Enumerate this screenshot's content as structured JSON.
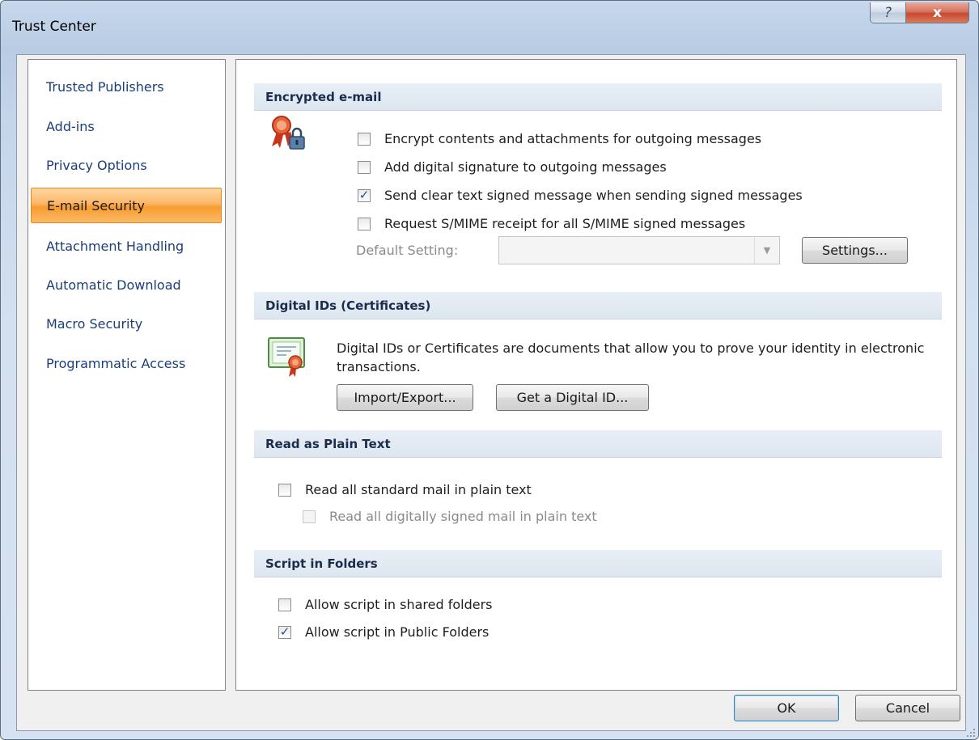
{
  "window": {
    "title": "Trust Center",
    "help_glyph": "?",
    "close_glyph": "x"
  },
  "sidebar": {
    "items": [
      {
        "label": "Trusted Publishers",
        "active": false
      },
      {
        "label": "Add-ins",
        "active": false
      },
      {
        "label": "Privacy Options",
        "active": false
      },
      {
        "label": "E-mail Security",
        "active": true
      },
      {
        "label": "Attachment Handling",
        "active": false
      },
      {
        "label": "Automatic Download",
        "active": false
      },
      {
        "label": "Macro Security",
        "active": false
      },
      {
        "label": "Programmatic Access",
        "active": false
      }
    ]
  },
  "encrypted": {
    "header": "Encrypted e-mail",
    "icon": "certificate-lock-icon",
    "options": [
      {
        "label": "Encrypt contents and attachments for outgoing messages",
        "checked": false
      },
      {
        "label": "Add digital signature to outgoing messages",
        "checked": false
      },
      {
        "label": "Send clear text signed message when sending signed messages",
        "checked": true
      },
      {
        "label": "Request S/MIME receipt for all S/MIME signed messages",
        "checked": false
      }
    ],
    "default_setting_label": "Default Setting:",
    "default_setting_value": "",
    "settings_button": "Settings..."
  },
  "digital_ids": {
    "header": "Digital IDs (Certificates)",
    "icon": "certificate-icon",
    "description": "Digital IDs or Certificates are documents that allow you to prove your identity in electronic transactions.",
    "import_export_button": "Import/Export...",
    "get_id_button": "Get a Digital ID..."
  },
  "plain_text": {
    "header": "Read as Plain Text",
    "options": [
      {
        "label": "Read all standard mail in plain text",
        "checked": false,
        "enabled": true
      },
      {
        "label": "Read all digitally signed mail in plain text",
        "checked": false,
        "enabled": false
      }
    ]
  },
  "script_folders": {
    "header": "Script in Folders",
    "options": [
      {
        "label": "Allow script in shared folders",
        "checked": false
      },
      {
        "label": "Allow script in Public Folders",
        "checked": true
      }
    ]
  },
  "footer": {
    "ok_button": "OK",
    "cancel_button": "Cancel"
  },
  "colors": {
    "active_nav": "#fbb566",
    "nav_text": "#1a3f7a",
    "header_bg": "#dde6f0"
  }
}
